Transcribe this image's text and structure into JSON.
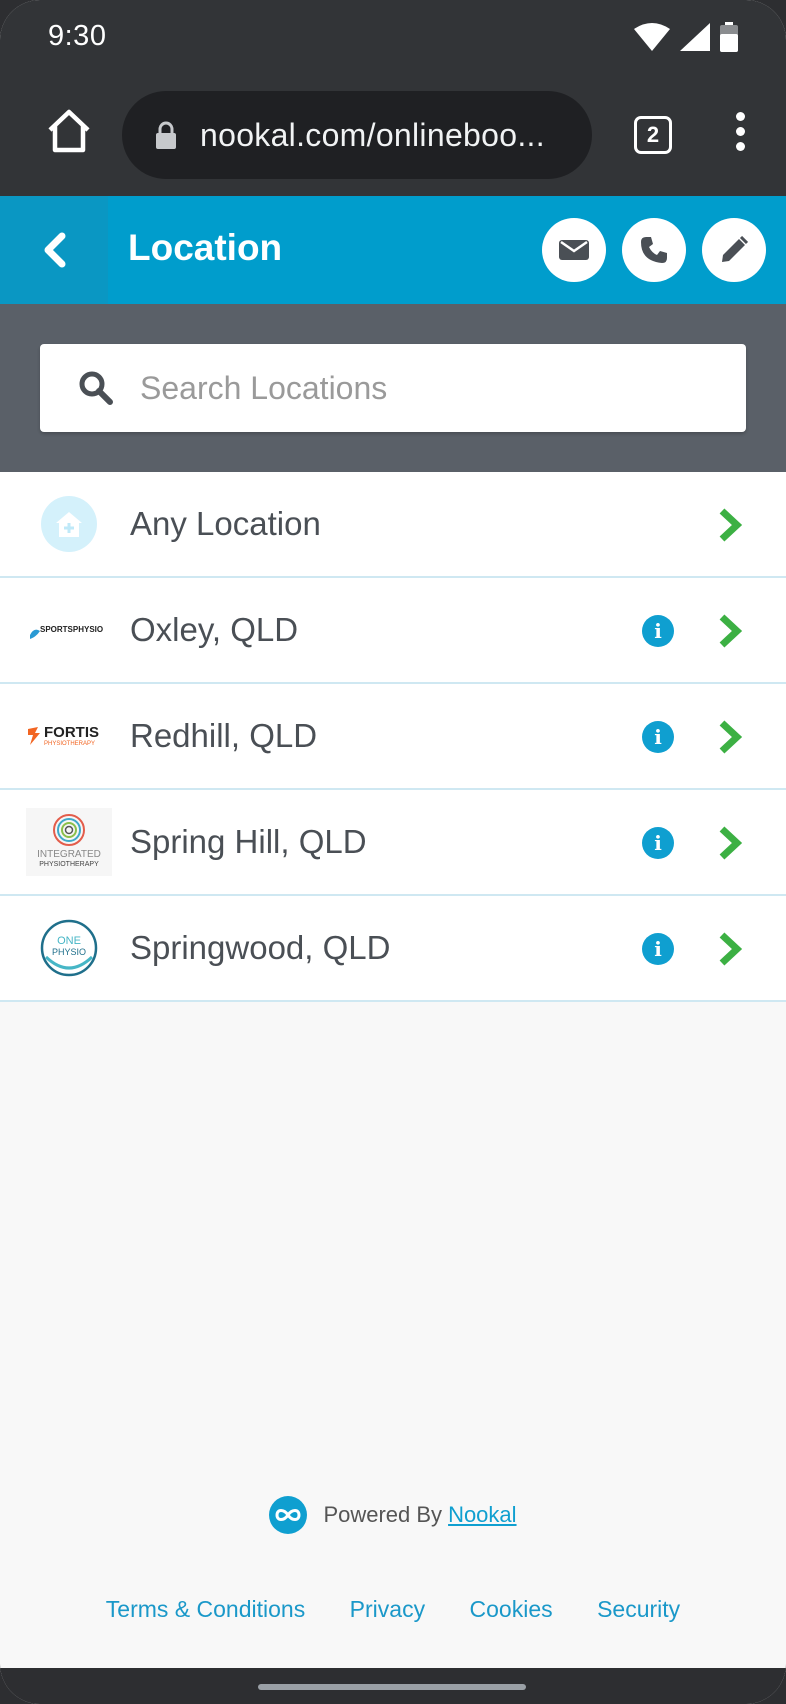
{
  "status_bar": {
    "time": "9:30"
  },
  "browser": {
    "url": "nookal.com/onlineboo...",
    "tab_count": "2"
  },
  "header": {
    "title": "Location",
    "actions": [
      "email-icon",
      "phone-icon",
      "edit-icon"
    ]
  },
  "search": {
    "placeholder": "Search Locations",
    "value": ""
  },
  "locations": [
    {
      "name": "Any Location",
      "logo": "house-icon",
      "has_info": false
    },
    {
      "name": "Oxley, QLD",
      "logo": "SPORTSPHYSIO",
      "has_info": true
    },
    {
      "name": "Redhill, QLD",
      "logo": "FORTIS",
      "logo_sub": "PHYSIOTHERAPY",
      "has_info": true
    },
    {
      "name": "Spring Hill, QLD",
      "logo": "INTEGRATED",
      "logo_sub": "PHYSIOTHERAPY",
      "has_info": true
    },
    {
      "name": "Springwood, QLD",
      "logo": "ONE",
      "logo_sub": "PHYSIO",
      "has_info": true
    }
  ],
  "footer": {
    "powered_by": "Powered By",
    "brand": "Nookal",
    "links": [
      "Terms & Conditions",
      "Privacy",
      "Cookies",
      "Security"
    ]
  },
  "colors": {
    "brand_blue": "#009dcc",
    "accent_green": "#3cb043",
    "info_blue": "#0f9fd0"
  }
}
